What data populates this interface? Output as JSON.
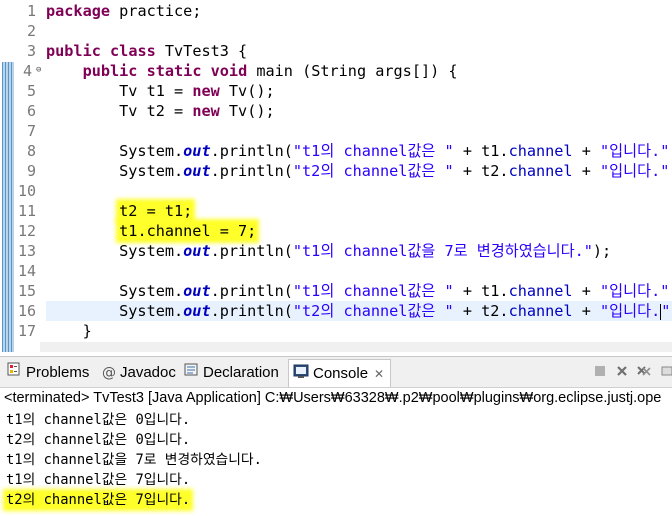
{
  "editor": {
    "line_numbers": [
      "1",
      "2",
      "3",
      "4",
      "5",
      "6",
      "7",
      "8",
      "9",
      "10",
      "11",
      "12",
      "13",
      "14",
      "15",
      "16",
      "17"
    ],
    "lines": {
      "l1": [
        "package",
        " practice;"
      ],
      "l3": [
        "public",
        " ",
        "class",
        " TvTest3 {"
      ],
      "l4": [
        "    ",
        "public",
        " ",
        "static",
        " ",
        "void",
        " main (String ",
        "args",
        "[]) {"
      ],
      "l5": [
        "        Tv ",
        "t1",
        " = ",
        "new",
        " Tv();"
      ],
      "l6": [
        "        Tv ",
        "t2",
        " = ",
        "new",
        " Tv();"
      ],
      "l8": [
        "        System.",
        "out",
        ".println(",
        "\"t1의 channel값은 \"",
        " + t1.",
        "channel",
        " + ",
        "\"입니다.\"",
        ");"
      ],
      "l9": [
        "        System.",
        "out",
        ".println(",
        "\"t2의 channel값은 \"",
        " + t2.",
        "channel",
        " + ",
        "\"입니다.\"",
        ");"
      ],
      "l11": [
        "        ",
        "t2 = t1;"
      ],
      "l12": [
        "        ",
        "t1.channel = 7;"
      ],
      "l13": [
        "        System.",
        "out",
        ".println(",
        "\"t1의 channel값을 7로 변경하였습니다.\"",
        ");"
      ],
      "l15": [
        "        System.",
        "out",
        ".println(",
        "\"t1의 channel값은 \"",
        " + t1.",
        "channel",
        " + ",
        "\"입니다.\"",
        ");"
      ],
      "l16": [
        "        System.",
        "out",
        ".println(",
        "\"t2의 channel값은 \"",
        " + t2.",
        "channel",
        " + ",
        "\"입니다.",
        "\"",
        ");"
      ],
      "l17": [
        "    }"
      ]
    }
  },
  "views": {
    "tabs": {
      "problems": "Problems",
      "javadoc": "Javadoc",
      "declaration": "Declaration",
      "console": "Console"
    },
    "console_close": "✕",
    "terminated": "<terminated> TvTest3 [Java Application] C:₩Users₩63328₩.p2₩pool₩plugins₩org.eclipse.justj.ope",
    "output": [
      "t1의 channel값은 0입니다.",
      "t2의 channel값은 0입니다.",
      "t1의 channel값을 7로 변경하였습니다.",
      "t1의 channel값은 7입니다.",
      "t2의 channel값은 7입니다."
    ]
  },
  "colors": {
    "keyword": "#7f0055",
    "string": "#2a00ff",
    "field": "#0000c0",
    "highlight": "#ffff2a",
    "current_line": "#e8f2fe"
  },
  "icons": [
    "problems-icon",
    "javadoc-icon",
    "declaration-icon",
    "console-icon",
    "terminate-icon",
    "remove-launch-icon",
    "remove-all-icon",
    "view-menu-icon"
  ]
}
